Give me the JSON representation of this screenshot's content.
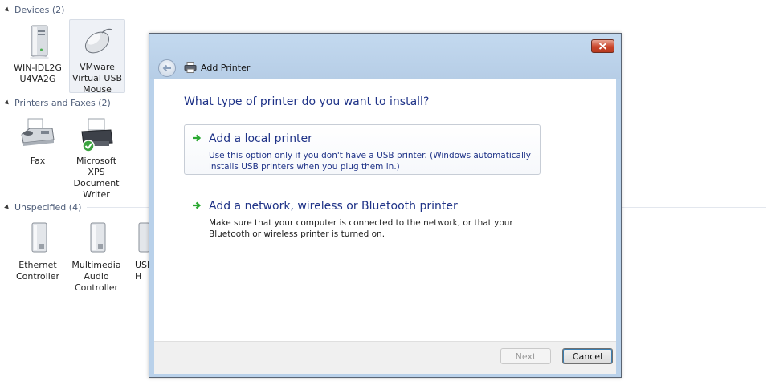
{
  "background": {
    "groups": [
      {
        "title": "Devices (2)",
        "items": [
          {
            "label": "WIN-IDL2G U4VA2G"
          },
          {
            "label": "VMware Virtual USB Mouse"
          }
        ]
      },
      {
        "title": "Printers and Faxes (2)",
        "items": [
          {
            "label": "Fax"
          },
          {
            "label": "Microsoft XPS Document Writer"
          }
        ]
      },
      {
        "title": "Unspecified (4)",
        "items": [
          {
            "label": "Ethernet Controller"
          },
          {
            "label": "Multimedia Audio Controller"
          },
          {
            "label": "USB H"
          }
        ]
      }
    ]
  },
  "dialog": {
    "title": "Add Printer",
    "heading": "What type of printer do you want to install?",
    "options": [
      {
        "title": "Add a local printer",
        "description": "Use this option only if you don't have a USB printer. (Windows automatically installs USB printers when you plug them in.)"
      },
      {
        "title": "Add a network, wireless or Bluetooth printer",
        "description": "Make sure that your computer is connected to the network, or that your Bluetooth or wireless printer is turned on."
      }
    ],
    "next_label": "Next",
    "cancel_label": "Cancel"
  },
  "colors": {
    "link_blue": "#1e3287",
    "group_header": "#4f5e7a",
    "close_red": "#c9452b",
    "arrow_green": "#2aa830",
    "frame": "#b9d1ea"
  },
  "icons": {
    "computer": "computer-tower-icon",
    "mouse": "mouse-icon",
    "fax": "fax-icon",
    "xps": "printer-icon",
    "generic": "generic-device-icon",
    "back": "back-arrow-icon",
    "close": "close-icon",
    "option_arrow": "green-arrow-icon"
  }
}
